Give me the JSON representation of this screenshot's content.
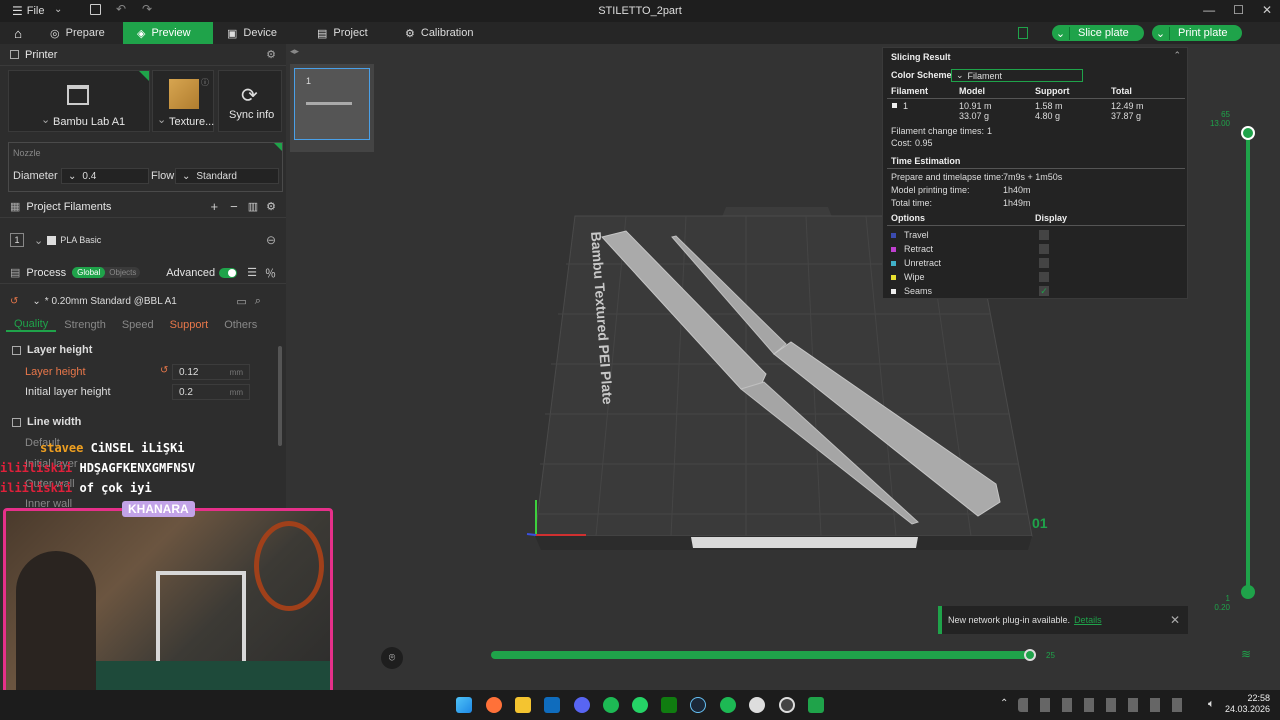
{
  "titlebar": {
    "menu_label": "File",
    "title": "STILETTO_2part"
  },
  "nav": {
    "tabs": [
      {
        "label": "Prepare",
        "icon": "prepare-icon"
      },
      {
        "label": "Preview",
        "icon": "preview-icon",
        "active": true
      },
      {
        "label": "Device",
        "icon": "device-icon"
      },
      {
        "label": "Project",
        "icon": "project-icon"
      },
      {
        "label": "Calibration",
        "icon": "calibration-icon"
      }
    ],
    "slice_label": "Slice plate",
    "print_label": "Print plate"
  },
  "printer": {
    "header": "Printer",
    "model": "Bambu Lab A1",
    "plate": "Texture...",
    "sync_label": "Sync info",
    "nozzle_header": "Nozzle",
    "diameter_label": "Diameter",
    "diameter_value": "0.4",
    "flow_label": "Flow",
    "flow_value": "Standard"
  },
  "filaments": {
    "header": "Project Filaments",
    "items": [
      {
        "index": "1",
        "name": "PLA Basic"
      }
    ]
  },
  "process": {
    "header": "Process",
    "toggle_global": "Global",
    "toggle_objects": "Objects",
    "advanced_label": "Advanced",
    "preset": "* 0.20mm Standard @BBL A1",
    "tabs": [
      "Quality",
      "Strength",
      "Speed",
      "Support",
      "Others"
    ],
    "layer_height_header": "Layer height",
    "layer_height_label": "Layer height",
    "layer_height_value": "0.12",
    "initial_layer_label": "Initial layer height",
    "initial_layer_value": "0.2",
    "unit": "mm",
    "line_width_header": "Line width",
    "lw_rows": [
      "Default",
      "Initial layer",
      "Outer wall",
      "Inner wall"
    ]
  },
  "overlay": {
    "line1a": "stavee",
    "line1b": "CiNSEL iLiŞKi",
    "line2a": "iliiliskii",
    "line2b": "HDŞAGFKENXGMFNSV",
    "line3a": "iliiliskii",
    "line3b": "of çok iyi",
    "cam_name": "KHANARA"
  },
  "plate_thumb": {
    "label": "1"
  },
  "bed": {
    "label": "Bambu Textured PEI Plate",
    "plate_number": "01"
  },
  "slicing_result": {
    "title": "Slicing Result",
    "color_scheme_label": "Color Scheme",
    "color_scheme_value": "Filament",
    "col_filament": "Filament",
    "col_model": "Model",
    "col_support": "Support",
    "col_total": "Total",
    "row_id": "1",
    "model_len": "10.91 m",
    "model_wt": "33.07 g",
    "support_len": "1.58 m",
    "support_wt": "4.80 g",
    "total_len": "12.49 m",
    "total_wt": "37.87 g",
    "change_label": "Filament change times:",
    "change_value": "1",
    "cost_label": "Cost:",
    "cost_value": "0.95",
    "time_header": "Time Estimation",
    "prep_label": "Prepare and timelapse time:",
    "prep_value": "7m9s + 1m50s",
    "model_time_label": "Model printing time:",
    "model_time_value": "1h40m",
    "total_time_label": "Total time:",
    "total_time_value": "1h49m",
    "options_label": "Options",
    "display_label": "Display",
    "options": [
      {
        "name": "Travel",
        "color": "#3b4bb0",
        "checked": false
      },
      {
        "name": "Retract",
        "color": "#c040d0",
        "checked": false
      },
      {
        "name": "Unretract",
        "color": "#40b0c8",
        "checked": false
      },
      {
        "name": "Wipe",
        "color": "#e8e030",
        "checked": false
      },
      {
        "name": "Seams",
        "color": "#eeeeee",
        "checked": true
      }
    ]
  },
  "layer_slider": {
    "top_a": "65",
    "top_b": "13.00",
    "bottom_a": "1",
    "bottom_b": "0.20"
  },
  "move_slider": {
    "value": "25"
  },
  "notification": {
    "text": "New network plug-in available.",
    "link": "Details"
  },
  "taskbar": {
    "time": "22:58",
    "date": "24.03.2026"
  },
  "colors": {
    "accent": "#1fa34a",
    "support_orange": "#e8774a",
    "cam_border": "#e6308a"
  }
}
